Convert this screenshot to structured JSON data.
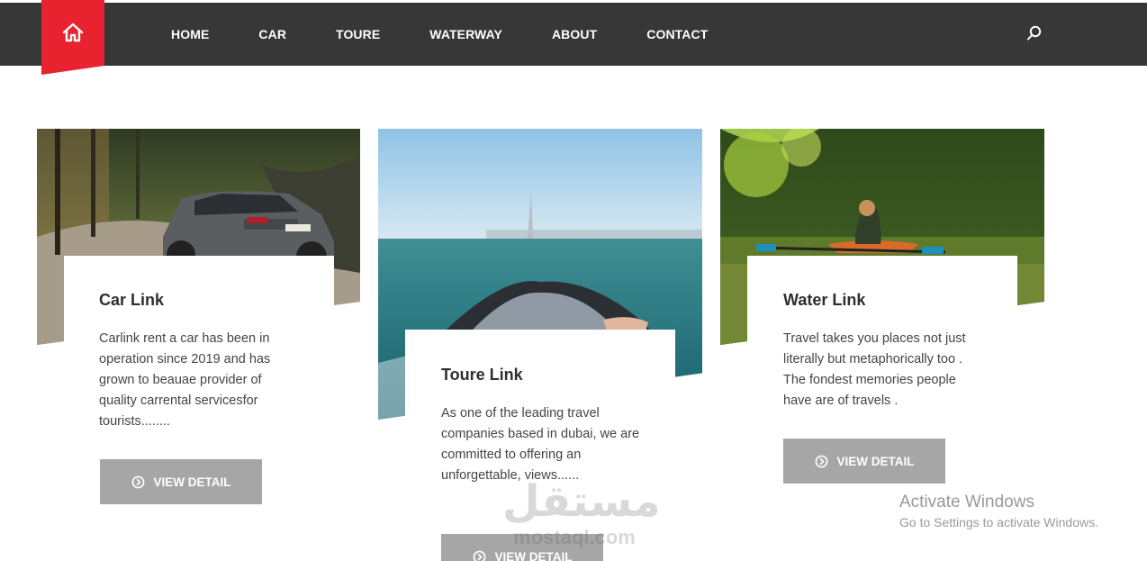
{
  "nav": {
    "items": [
      {
        "label": "HOME"
      },
      {
        "label": "CAR"
      },
      {
        "label": "TOURE"
      },
      {
        "label": "WATERWAY"
      },
      {
        "label": "ABOUT"
      },
      {
        "label": "CONTACT"
      }
    ]
  },
  "icons": {
    "home": "home-icon",
    "search": "search-icon",
    "button": "circle-chevron-right-icon"
  },
  "colors": {
    "topbar": "#373737",
    "accent": "#e8222e",
    "button": "#a6a6a6"
  },
  "cards": [
    {
      "title": "Car Link",
      "text": "Carlink rent a car has been in operation since 2019 and has grown to beauae provider of quality carrental servicesfor tourists........",
      "button": "VIEW DETAIL"
    },
    {
      "title": "Toure Link",
      "text": "As one of the leading travel companies based in dubai, we are committed to offering an unforgettable, views......",
      "button": "VIEW DETAIL"
    },
    {
      "title": "Water Link",
      "text": "Travel takes you places not just literally but metaphorically too . The fondest memories people have are of travels .",
      "button": "VIEW DETAIL"
    }
  ],
  "watermark": {
    "title": "Activate Windows",
    "subtitle": "Go to Settings to activate Windows.",
    "logo_text": "مستقل",
    "logo_sub": "mostaql.com"
  }
}
